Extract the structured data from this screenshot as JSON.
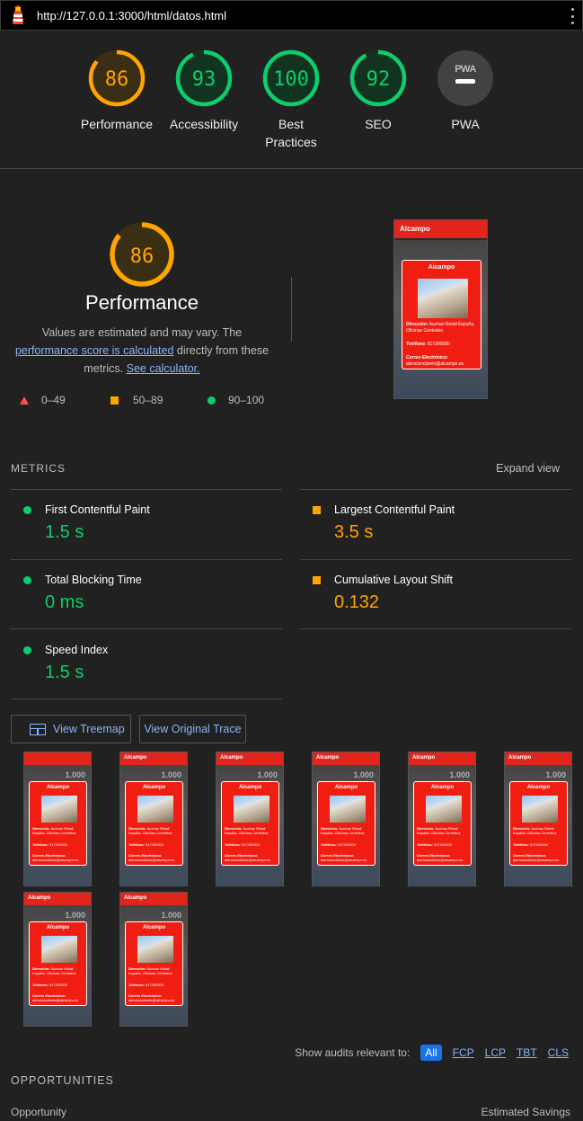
{
  "browser": {
    "url": "http://127.0.0.1:3000/html/datos.html",
    "logo_icon": "lighthouse-icon",
    "menu_icon": "kebab-menu-icon"
  },
  "colors": {
    "pass": "#0cce6b",
    "average": "#ffa400",
    "fail": "#ff4e42",
    "link": "#8ab4f8",
    "background": "#212121"
  },
  "summary": {
    "gauges": [
      {
        "label": "Performance",
        "score": "86",
        "value": 86,
        "status": "average"
      },
      {
        "label": "Accessibility",
        "score": "93",
        "value": 93,
        "status": "pass"
      },
      {
        "label": "Best Practices",
        "score": "100",
        "value": 100,
        "status": "pass"
      },
      {
        "label": "SEO",
        "score": "92",
        "value": 92,
        "status": "pass"
      },
      {
        "label": "PWA",
        "score": "",
        "value": null,
        "status": "na"
      }
    ]
  },
  "performance": {
    "score": "86",
    "value": 86,
    "title": "Performance",
    "desc_prefix": "Values are estimated and may vary. The ",
    "desc_link1": "performance score is calculated",
    "desc_middle": " directly from these metrics. ",
    "desc_link2": "See calculator.",
    "legend": [
      {
        "range": "0–49",
        "shape": "triangle"
      },
      {
        "range": "50–89",
        "shape": "square"
      },
      {
        "range": "90–100",
        "shape": "circle"
      }
    ]
  },
  "thumbnail": {
    "brand": "Alcampo",
    "card_title": "Alcampo",
    "address_label": "Dirección:",
    "address_value": "Auchan Retail España, Oficinas Centrales",
    "phone_label": "Teléfono:",
    "phone_value": "917300000",
    "email_label": "Correo Electrónico:",
    "email_value": "atencioncliente@alcampo.es",
    "banner_text": "1.000"
  },
  "metrics": {
    "heading": "METRICS",
    "expand_label": "Expand view",
    "items": [
      {
        "name": "First Contentful Paint",
        "value": "1.5 s",
        "status": "pass"
      },
      {
        "name": "Largest Contentful Paint",
        "value": "3.5 s",
        "status": "average"
      },
      {
        "name": "Total Blocking Time",
        "value": "0 ms",
        "status": "pass"
      },
      {
        "name": "Cumulative Layout Shift",
        "value": "0.132",
        "status": "average"
      },
      {
        "name": "Speed Index",
        "value": "1.5 s",
        "status": "pass"
      }
    ]
  },
  "buttons": {
    "treemap": "View Treemap",
    "treemap_icon": "treemap-icon",
    "trace": "View Original Trace"
  },
  "audit_filter": {
    "label": "Show audits relevant to:",
    "options": [
      "All",
      "FCP",
      "LCP",
      "TBT",
      "CLS"
    ],
    "active": "All"
  },
  "opportunities": {
    "heading": "OPPORTUNITIES",
    "col_left": "Opportunity",
    "col_right": "Estimated Savings"
  }
}
